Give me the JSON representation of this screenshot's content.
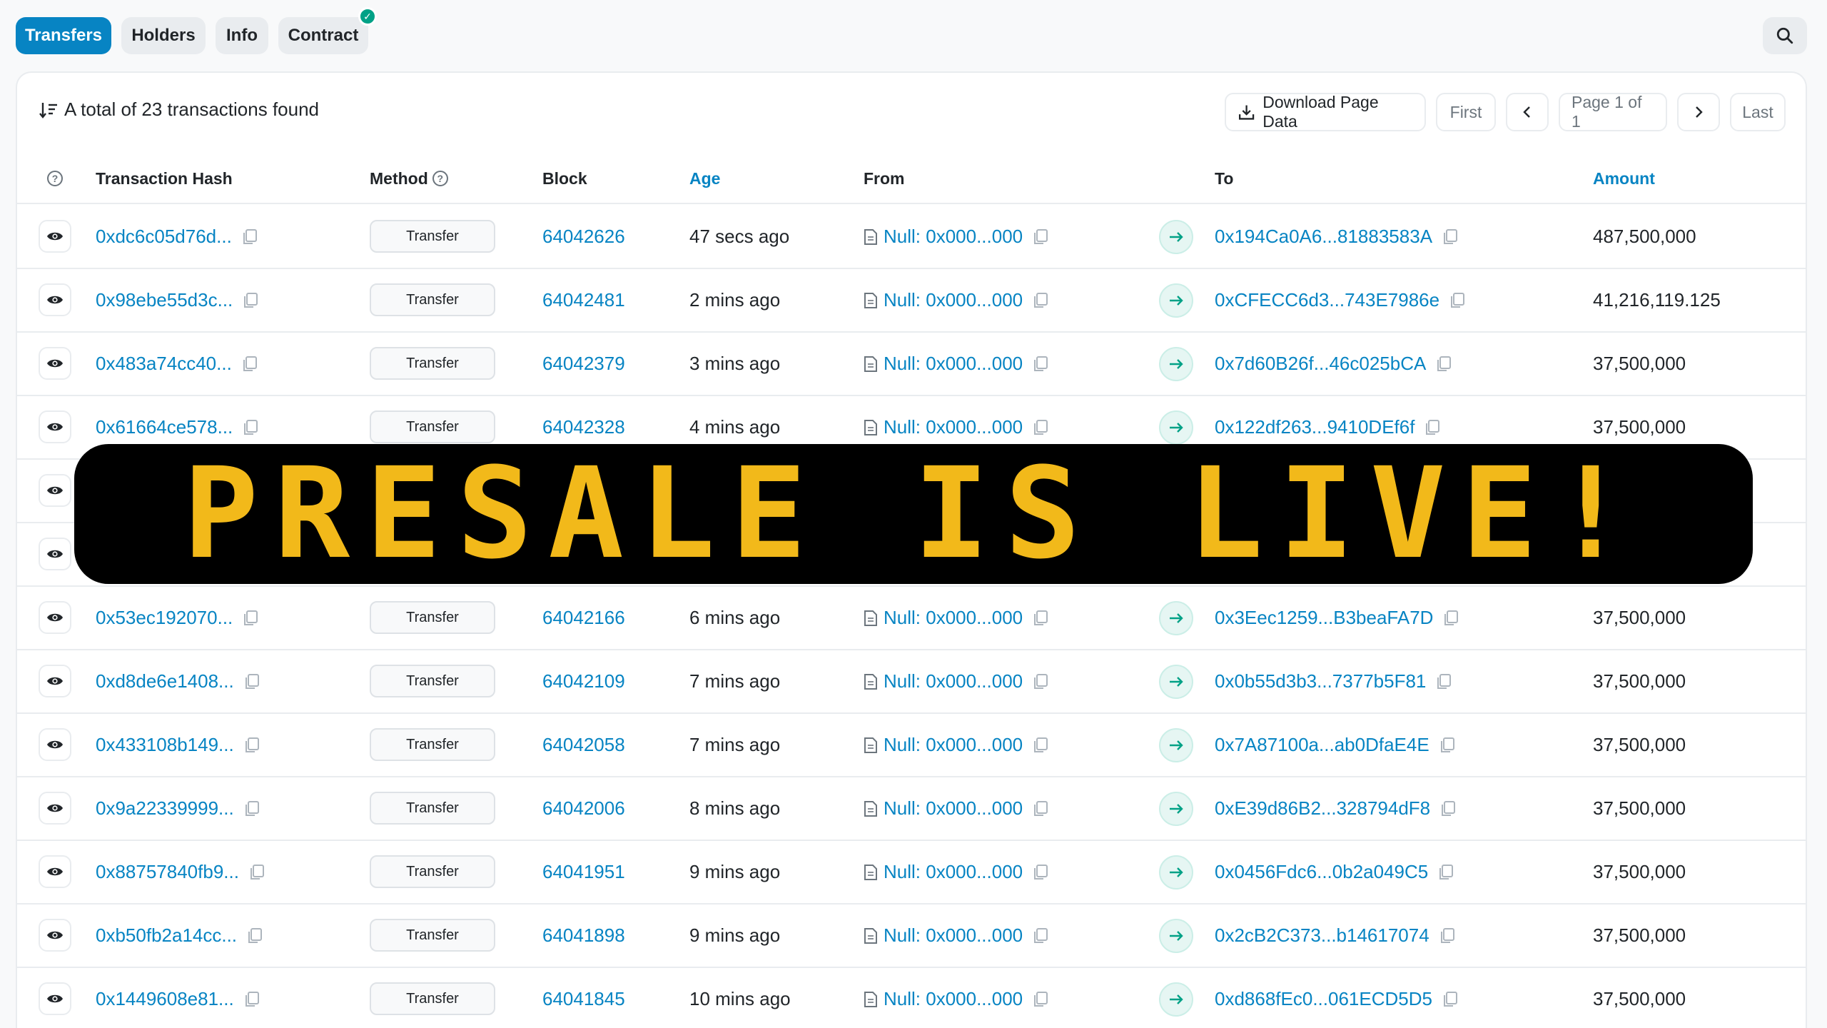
{
  "tabs": [
    {
      "label": "Transfers",
      "active": true
    },
    {
      "label": "Holders",
      "active": false
    },
    {
      "label": "Info",
      "active": false
    },
    {
      "label": "Contract",
      "active": false,
      "verified": true
    }
  ],
  "summary": {
    "text": "A total of 23 transactions found"
  },
  "pager": {
    "download": "Download Page Data",
    "first": "First",
    "page": "Page 1 of 1",
    "last": "Last"
  },
  "columns": {
    "hash": "Transaction Hash",
    "method": "Method",
    "block": "Block",
    "age": "Age",
    "from": "From",
    "to": "To",
    "amount": "Amount"
  },
  "rows": [
    {
      "hash": "0xdc6c05d76d...",
      "method": "Transfer",
      "block": "64042626",
      "age": "47 secs ago",
      "from": "Null: 0x000...000",
      "to": "0x194Ca0A6...81883583A",
      "amount": "487,500,000"
    },
    {
      "hash": "0x98ebe55d3c...",
      "method": "Transfer",
      "block": "64042481",
      "age": "2 mins ago",
      "from": "Null: 0x000...000",
      "to": "0xCFECC6d3...743E7986e",
      "amount": "41,216,119.125"
    },
    {
      "hash": "0x483a74cc40...",
      "method": "Transfer",
      "block": "64042379",
      "age": "3 mins ago",
      "from": "Null: 0x000...000",
      "to": "0x7d60B26f...46c025bCA",
      "amount": "37,500,000"
    },
    {
      "hash": "0x61664ce578...",
      "method": "Transfer",
      "block": "64042328",
      "age": "4 mins ago",
      "from": "Null: 0x000...000",
      "to": "0x122df263...9410DEf6f",
      "amount": "37,500,000"
    },
    {
      "hash": "",
      "method": "",
      "block": "",
      "age": "",
      "from": "",
      "to": "",
      "amount": ""
    },
    {
      "hash": "",
      "method": "",
      "block": "",
      "age": "",
      "from": "",
      "to": "",
      "amount": ""
    },
    {
      "hash": "0x53ec192070...",
      "method": "Transfer",
      "block": "64042166",
      "age": "6 mins ago",
      "from": "Null: 0x000...000",
      "to": "0x3Eec1259...B3beaFA7D",
      "amount": "37,500,000"
    },
    {
      "hash": "0xd8de6e1408...",
      "method": "Transfer",
      "block": "64042109",
      "age": "7 mins ago",
      "from": "Null: 0x000...000",
      "to": "0x0b55d3b3...7377b5F81",
      "amount": "37,500,000"
    },
    {
      "hash": "0x433108b149...",
      "method": "Transfer",
      "block": "64042058",
      "age": "7 mins ago",
      "from": "Null: 0x000...000",
      "to": "0x7A87100a...ab0DfaE4E",
      "amount": "37,500,000"
    },
    {
      "hash": "0x9a22339999...",
      "method": "Transfer",
      "block": "64042006",
      "age": "8 mins ago",
      "from": "Null: 0x000...000",
      "to": "0xE39d86B2...328794dF8",
      "amount": "37,500,000"
    },
    {
      "hash": "0x88757840fb9...",
      "method": "Transfer",
      "block": "64041951",
      "age": "9 mins ago",
      "from": "Null: 0x000...000",
      "to": "0x0456Fdc6...0b2a049C5",
      "amount": "37,500,000"
    },
    {
      "hash": "0xb50fb2a14cc...",
      "method": "Transfer",
      "block": "64041898",
      "age": "9 mins ago",
      "from": "Null: 0x000...000",
      "to": "0x2cB2C373...b14617074",
      "amount": "37,500,000"
    },
    {
      "hash": "0x1449608e81...",
      "method": "Transfer",
      "block": "64041845",
      "age": "10 mins ago",
      "from": "Null: 0x000...000",
      "to": "0xd868fEc0...061ECD5D5",
      "amount": "37,500,000"
    }
  ],
  "banner": {
    "text": "PRESALE IS LIVE!"
  },
  "icons": {
    "search": "search-icon",
    "sort": "sort-icon",
    "download": "download-icon",
    "eye": "eye-icon",
    "copy": "copy-icon",
    "doc": "document-icon",
    "arrow": "arrow-right-icon",
    "help": "help-icon",
    "check": "check-icon"
  },
  "colors": {
    "accent": "#0784c3",
    "banner_bg": "#000000",
    "banner_text": "#f2b91a",
    "success": "#00a186"
  }
}
